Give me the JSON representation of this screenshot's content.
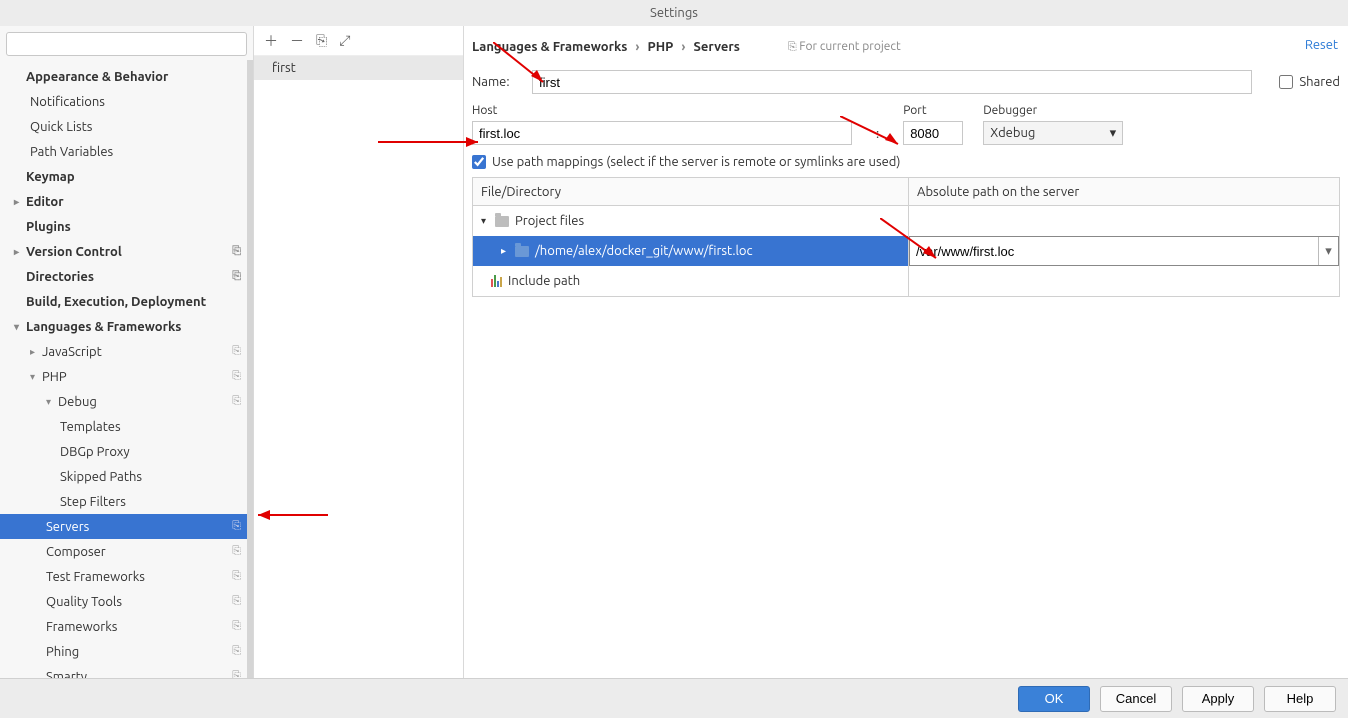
{
  "window": {
    "title": "Settings"
  },
  "sidebar": {
    "search_placeholder": "",
    "items": {
      "appearance": "Appearance & Behavior",
      "notifications": "Notifications",
      "quicklists": "Quick Lists",
      "pathvars": "Path Variables",
      "keymap": "Keymap",
      "editor": "Editor",
      "plugins": "Plugins",
      "vcs": "Version Control",
      "directories": "Directories",
      "build": "Build, Execution, Deployment",
      "langfw": "Languages & Frameworks",
      "javascript": "JavaScript",
      "php": "PHP",
      "debug": "Debug",
      "templates": "Templates",
      "dbgp": "DBGp Proxy",
      "skipped": "Skipped Paths",
      "stepfilters": "Step Filters",
      "servers": "Servers",
      "composer": "Composer",
      "testfw": "Test Frameworks",
      "quality": "Quality Tools",
      "frameworks": "Frameworks",
      "phing": "Phing",
      "smarty": "Smarty"
    }
  },
  "breadcrumbs": {
    "a": "Languages & Frameworks",
    "b": "PHP",
    "c": "Servers",
    "hint": "For current project",
    "reset": "Reset"
  },
  "serverlist": {
    "item0": "first"
  },
  "form": {
    "name_label": "Name:",
    "name_value": "first",
    "shared_label": "Shared",
    "host_label": "Host",
    "host_value": "first.loc",
    "port_label": "Port",
    "port_value": "8080",
    "debugger_label": "Debugger",
    "debugger_value": "Xdebug",
    "pathmap_label": "Use path mappings (select if the server is remote or symlinks are used)",
    "col1": "File/Directory",
    "col2": "Absolute path on the server",
    "project_files": "Project files",
    "local_path": "/home/alex/docker_git/www/first.loc",
    "remote_path": "/var/www/first.loc",
    "include_path": "Include path"
  },
  "buttons": {
    "ok": "OK",
    "cancel": "Cancel",
    "apply": "Apply",
    "help": "Help"
  }
}
